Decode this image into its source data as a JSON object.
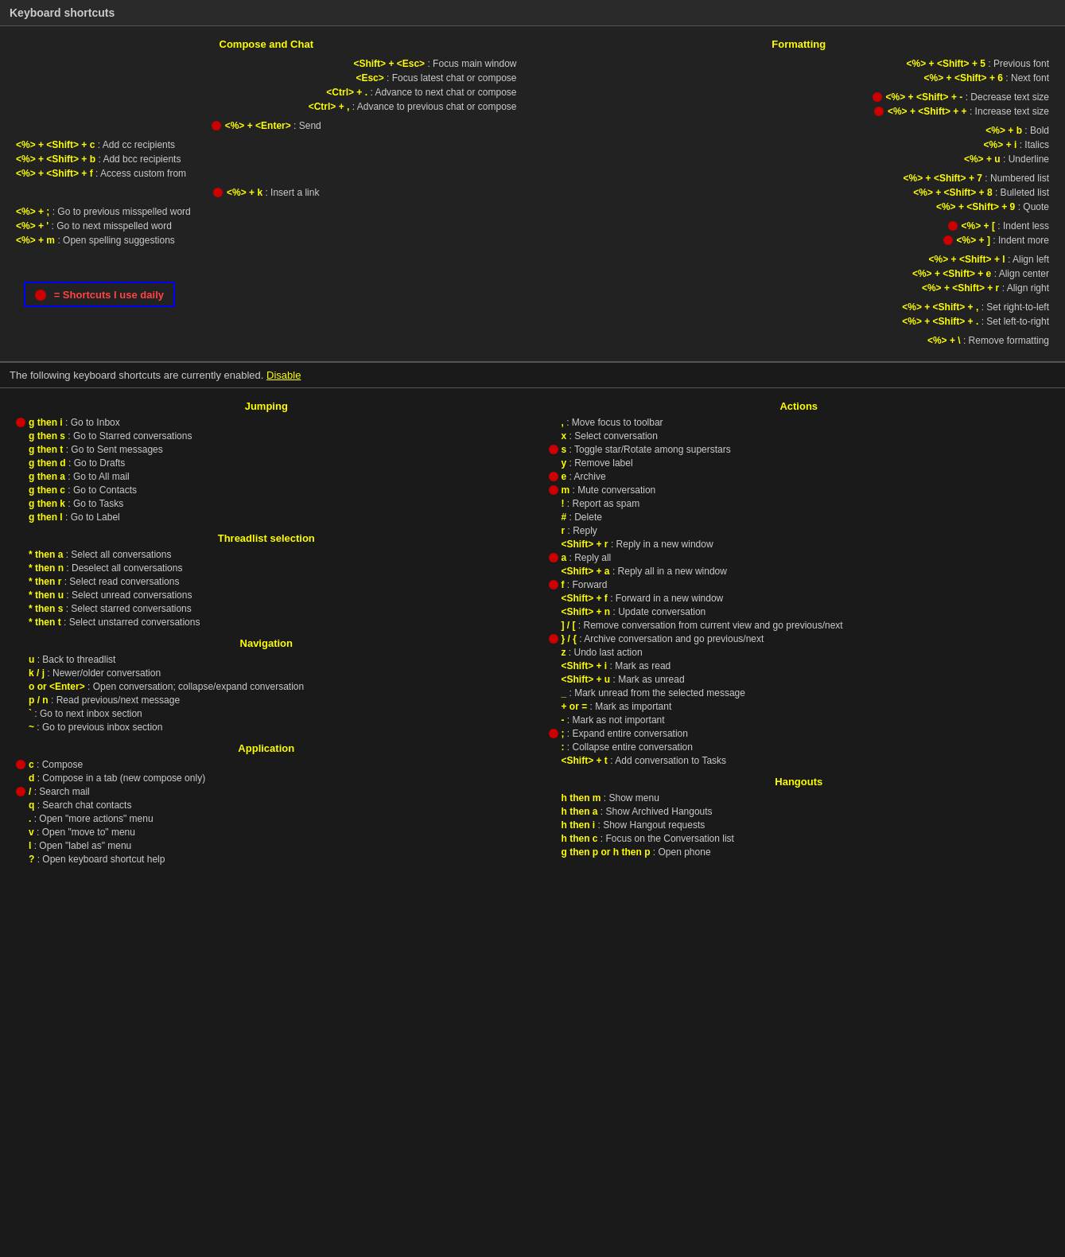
{
  "header": {
    "title": "Keyboard shortcuts"
  },
  "top": {
    "compose_chat": {
      "title": "Compose and Chat",
      "shortcuts": [
        {
          "keys": "<Shift> + <Esc>",
          "desc": "Focus main window",
          "daily": false,
          "indent": true
        },
        {
          "keys": "<Esc>",
          "desc": "Focus latest chat or compose",
          "daily": false,
          "indent": true
        },
        {
          "keys": "<Ctrl> + .",
          "desc": "Advance to next chat or compose",
          "daily": false,
          "indent": true
        },
        {
          "keys": "<Ctrl> + ,",
          "desc": "Advance to previous chat or compose",
          "daily": false,
          "indent": true
        }
      ],
      "send": {
        "keys": "<%> + <Enter>",
        "desc": "Send",
        "daily": true
      },
      "shortcuts2": [
        {
          "keys": "<%> + <Shift> + c",
          "desc": "Add cc recipients",
          "daily": false
        },
        {
          "keys": "<%> + <Shift> + b",
          "desc": "Add bcc recipients",
          "daily": false
        },
        {
          "keys": "<%> + <Shift> + f",
          "desc": "Access custom from",
          "daily": false
        }
      ],
      "link": {
        "keys": "<%> + k",
        "desc": "Insert a link",
        "daily": true
      },
      "spelling": [
        {
          "keys": "<%> + ;",
          "desc": "Go to previous misspelled word",
          "daily": false
        },
        {
          "keys": "<%> + '",
          "desc": "Go to next misspelled word",
          "daily": false
        },
        {
          "keys": "<%> + m",
          "desc": "Open spelling suggestions",
          "daily": false
        }
      ]
    },
    "formatting": {
      "title": "Formatting",
      "shortcuts": [
        {
          "keys": "<%> + <Shift> + 5",
          "desc": "Previous font",
          "daily": false,
          "right": true
        },
        {
          "keys": "<%> + <Shift> + 6",
          "desc": "Next font",
          "daily": false,
          "right": true
        }
      ],
      "size": [
        {
          "keys": "<%> + <Shift> + -",
          "desc": "Decrease text size",
          "daily": true,
          "right": true
        },
        {
          "keys": "<%> + <Shift> + +",
          "desc": "Increase text size",
          "daily": true,
          "right": true
        }
      ],
      "style": [
        {
          "keys": "<%> + b",
          "desc": "Bold",
          "daily": false,
          "right": true
        },
        {
          "keys": "<%> + i",
          "desc": "Italics",
          "daily": false,
          "right": true
        },
        {
          "keys": "<%> + u",
          "desc": "Underline",
          "daily": false,
          "right": true
        }
      ],
      "lists": [
        {
          "keys": "<%> + <Shift> + 7",
          "desc": "Numbered list",
          "daily": false,
          "right": true
        },
        {
          "keys": "<%> + <Shift> + 8",
          "desc": "Bulleted list",
          "daily": false,
          "right": true
        },
        {
          "keys": "<%> + <Shift> + 9",
          "desc": "Quote",
          "daily": false,
          "right": true
        }
      ],
      "indent": [
        {
          "keys": "<%> + [",
          "desc": "Indent less",
          "daily": true,
          "right": true
        },
        {
          "keys": "<%> + ]",
          "desc": "Indent more",
          "daily": true,
          "right": true
        }
      ],
      "align": [
        {
          "keys": "<%> + <Shift> + l",
          "desc": "Align left",
          "daily": false,
          "right": true
        },
        {
          "keys": "<%> + <Shift> + e",
          "desc": "Align center",
          "daily": false,
          "right": true
        },
        {
          "keys": "<%> + <Shift> + r",
          "desc": "Align right",
          "daily": false,
          "right": true
        }
      ],
      "rtl": [
        {
          "keys": "<%> + <Shift> + ,",
          "desc": "Set right-to-left",
          "daily": false,
          "right": true
        },
        {
          "keys": "<%> + <Shift> + .",
          "desc": "Set left-to-right",
          "daily": false,
          "right": true
        }
      ],
      "remove": [
        {
          "keys": "<%> + \\",
          "desc": "Remove formatting",
          "daily": false,
          "right": true
        }
      ]
    }
  },
  "legend": {
    "text": "= Shortcuts I use daily"
  },
  "enabled_bar": {
    "text": "The following keyboard shortcuts are currently enabled.",
    "link_text": "Disable"
  },
  "bottom": {
    "jumping": {
      "title": "Jumping",
      "items": [
        {
          "key": "g then i",
          "desc": "Go to Inbox",
          "daily": true
        },
        {
          "key": "g then s",
          "desc": "Go to Starred conversations",
          "daily": false
        },
        {
          "key": "g then t",
          "desc": "Go to Sent messages",
          "daily": false
        },
        {
          "key": "g then d",
          "desc": "Go to Drafts",
          "daily": false
        },
        {
          "key": "g then a",
          "desc": "Go to All mail",
          "daily": false
        },
        {
          "key": "g then c",
          "desc": "Go to Contacts",
          "daily": false
        },
        {
          "key": "g then k",
          "desc": "Go to Tasks",
          "daily": false
        },
        {
          "key": "g then l",
          "desc": "Go to Label",
          "daily": false
        }
      ]
    },
    "threadlist": {
      "title": "Threadlist selection",
      "items": [
        {
          "key": "* then a",
          "desc": "Select all conversations",
          "daily": false
        },
        {
          "key": "* then n",
          "desc": "Deselect all conversations",
          "daily": false
        },
        {
          "key": "* then r",
          "desc": "Select read conversations",
          "daily": false
        },
        {
          "key": "* then u",
          "desc": "Select unread conversations",
          "daily": false
        },
        {
          "key": "* then s",
          "desc": "Select starred conversations",
          "daily": false
        },
        {
          "key": "* then t",
          "desc": "Select unstarred conversations",
          "daily": false
        }
      ]
    },
    "navigation": {
      "title": "Navigation",
      "items": [
        {
          "key": "u",
          "desc": "Back to threadlist",
          "daily": false
        },
        {
          "key": "k / j",
          "desc": "Newer/older conversation",
          "daily": false
        },
        {
          "key": "o or <Enter>",
          "desc": "Open conversation; collapse/expand conversation",
          "daily": false
        },
        {
          "key": "p / n",
          "desc": "Read previous/next message",
          "daily": false
        },
        {
          "key": "`",
          "desc": "Go to next inbox section",
          "daily": false
        },
        {
          "key": "~",
          "desc": "Go to previous inbox section",
          "daily": false
        }
      ]
    },
    "application": {
      "title": "Application",
      "items": [
        {
          "key": "c",
          "desc": "Compose",
          "daily": true
        },
        {
          "key": "d",
          "desc": "Compose in a tab (new compose only)",
          "daily": false
        },
        {
          "key": "/",
          "desc": "Search mail",
          "daily": true
        },
        {
          "key": "q",
          "desc": "Search chat contacts",
          "daily": false
        },
        {
          "key": ".",
          "desc": "Open \"more actions\" menu",
          "daily": false
        },
        {
          "key": "v",
          "desc": "Open \"move to\" menu",
          "daily": false
        },
        {
          "key": "l",
          "desc": "Open \"label as\" menu",
          "daily": false
        },
        {
          "key": "?",
          "desc": "Open keyboard shortcut help",
          "daily": false
        }
      ]
    },
    "actions": {
      "title": "Actions",
      "items": [
        {
          "key": ",",
          "desc": "Move focus to toolbar",
          "daily": false
        },
        {
          "key": "x",
          "desc": "Select conversation",
          "daily": false
        },
        {
          "key": "s",
          "desc": "Toggle star/Rotate among superstars",
          "daily": true
        },
        {
          "key": "y",
          "desc": "Remove label",
          "daily": false
        },
        {
          "key": "e",
          "desc": "Archive",
          "daily": true
        },
        {
          "key": "m",
          "desc": "Mute conversation",
          "daily": true
        },
        {
          "key": "!",
          "desc": "Report as spam",
          "daily": false
        },
        {
          "key": "#",
          "desc": "Delete",
          "daily": false
        },
        {
          "key": "r",
          "desc": "Reply",
          "daily": false
        },
        {
          "key": "<Shift> + r",
          "desc": "Reply in a new window",
          "daily": false
        },
        {
          "key": "a",
          "desc": "Reply all",
          "daily": true
        },
        {
          "key": "<Shift> + a",
          "desc": "Reply all in a new window",
          "daily": false
        },
        {
          "key": "f",
          "desc": "Forward",
          "daily": true
        },
        {
          "key": "<Shift> + f",
          "desc": "Forward in a new window",
          "daily": false
        },
        {
          "key": "<Shift> + n",
          "desc": "Update conversation",
          "daily": false
        },
        {
          "key": "] / [",
          "desc": "Remove conversation from current view and go previous/next",
          "daily": false
        },
        {
          "key": "} / {",
          "desc": "Archive conversation and go previous/next",
          "daily": true
        },
        {
          "key": "z",
          "desc": "Undo last action",
          "daily": false
        },
        {
          "key": "<Shift> + i",
          "desc": "Mark as read",
          "daily": false
        },
        {
          "key": "<Shift> + u",
          "desc": "Mark as unread",
          "daily": false
        },
        {
          "key": "_",
          "desc": "Mark unread from the selected message",
          "daily": false
        },
        {
          "key": "+ or =",
          "desc": "Mark as important",
          "daily": false
        },
        {
          "key": "-",
          "desc": "Mark as not important",
          "daily": false
        },
        {
          "key": ";",
          "desc": "Expand entire conversation",
          "daily": true
        },
        {
          "key": ":",
          "desc": "Collapse entire conversation",
          "daily": false
        },
        {
          "key": "<Shift> + t",
          "desc": "Add conversation to Tasks",
          "daily": false
        }
      ]
    },
    "hangouts": {
      "title": "Hangouts",
      "items": [
        {
          "key": "h then m",
          "desc": "Show menu",
          "daily": false
        },
        {
          "key": "h then a",
          "desc": "Show Archived Hangouts",
          "daily": false
        },
        {
          "key": "h then i",
          "desc": "Show Hangout requests",
          "daily": false
        },
        {
          "key": "h then c",
          "desc": "Focus on the Conversation list",
          "daily": false
        },
        {
          "key": "g then p or h then p",
          "desc": "Open phone",
          "daily": false
        }
      ]
    }
  }
}
